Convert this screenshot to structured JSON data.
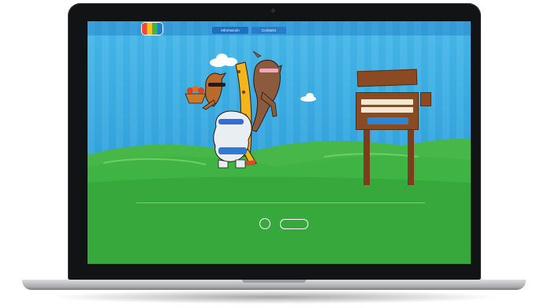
{
  "nav": {
    "tabs": [
      "Información",
      "Contacto"
    ]
  },
  "login": {
    "sign_title": "",
    "username_placeholder": "",
    "password_placeholder": "",
    "button_label": ""
  },
  "footer": {
    "col1": {
      "title": "",
      "brand": "",
      "subtitle": ""
    },
    "col2": {
      "title": "",
      "logo2": ""
    },
    "col3": {
      "title": "",
      "link": ""
    }
  },
  "colors": {
    "sky": "#39a8e3",
    "grass": "#3fb344",
    "wood": "#8a4a22",
    "nav_accent": "#1f6fbd"
  },
  "icons": [
    "laptop-camera-icon",
    "site-logo-icon",
    "cloud-icon",
    "fox-character-icon",
    "giraffe-character-icon",
    "cow-character-icon",
    "hippo-character-icon",
    "tree-pan-icon"
  ]
}
